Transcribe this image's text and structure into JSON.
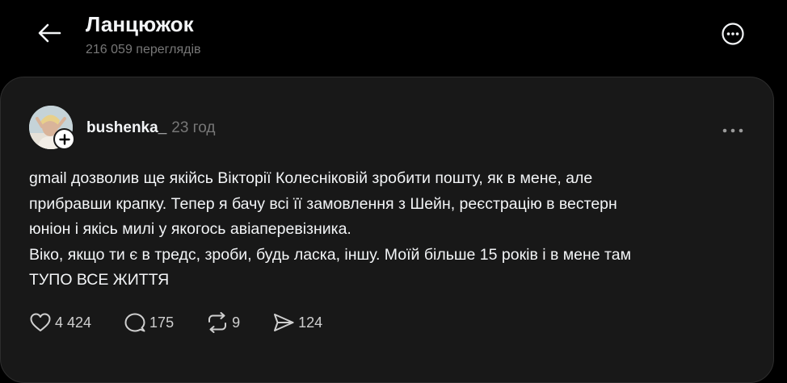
{
  "header": {
    "title": "Ланцюжок",
    "views": "216 059 переглядів"
  },
  "post": {
    "author": "bushenka_",
    "time": "23 год",
    "lines": [
      "gmail дозволив ще якійсь Вікторії Колесніковій зробити пошту, як в мене, але",
      "прибравши крапку. Тепер я бачу всі її замовлення з Шейн, реєстрацію в вестерн",
      "юніон і якісь милі у якогось авіаперевізника.",
      "Віко, якщо ти є в тредс, зроби, будь ласка, іншу. Моїй більше 15 років і в мене там",
      "ТУПО ВСЕ ЖИТТЯ"
    ],
    "actions": {
      "likes": "4 424",
      "replies": "175",
      "reposts": "9",
      "shares": "124"
    }
  },
  "icons": {
    "back": "arrow-left-icon",
    "more": "more-circle-icon",
    "post_more": "ellipsis-icon",
    "follow": "plus-icon",
    "like": "heart-icon",
    "reply": "comment-icon",
    "repost": "repost-icon",
    "share": "send-icon"
  },
  "colors": {
    "background": "#000000",
    "card": "#181818",
    "text": "#f3f5f7",
    "muted": "#777777"
  }
}
